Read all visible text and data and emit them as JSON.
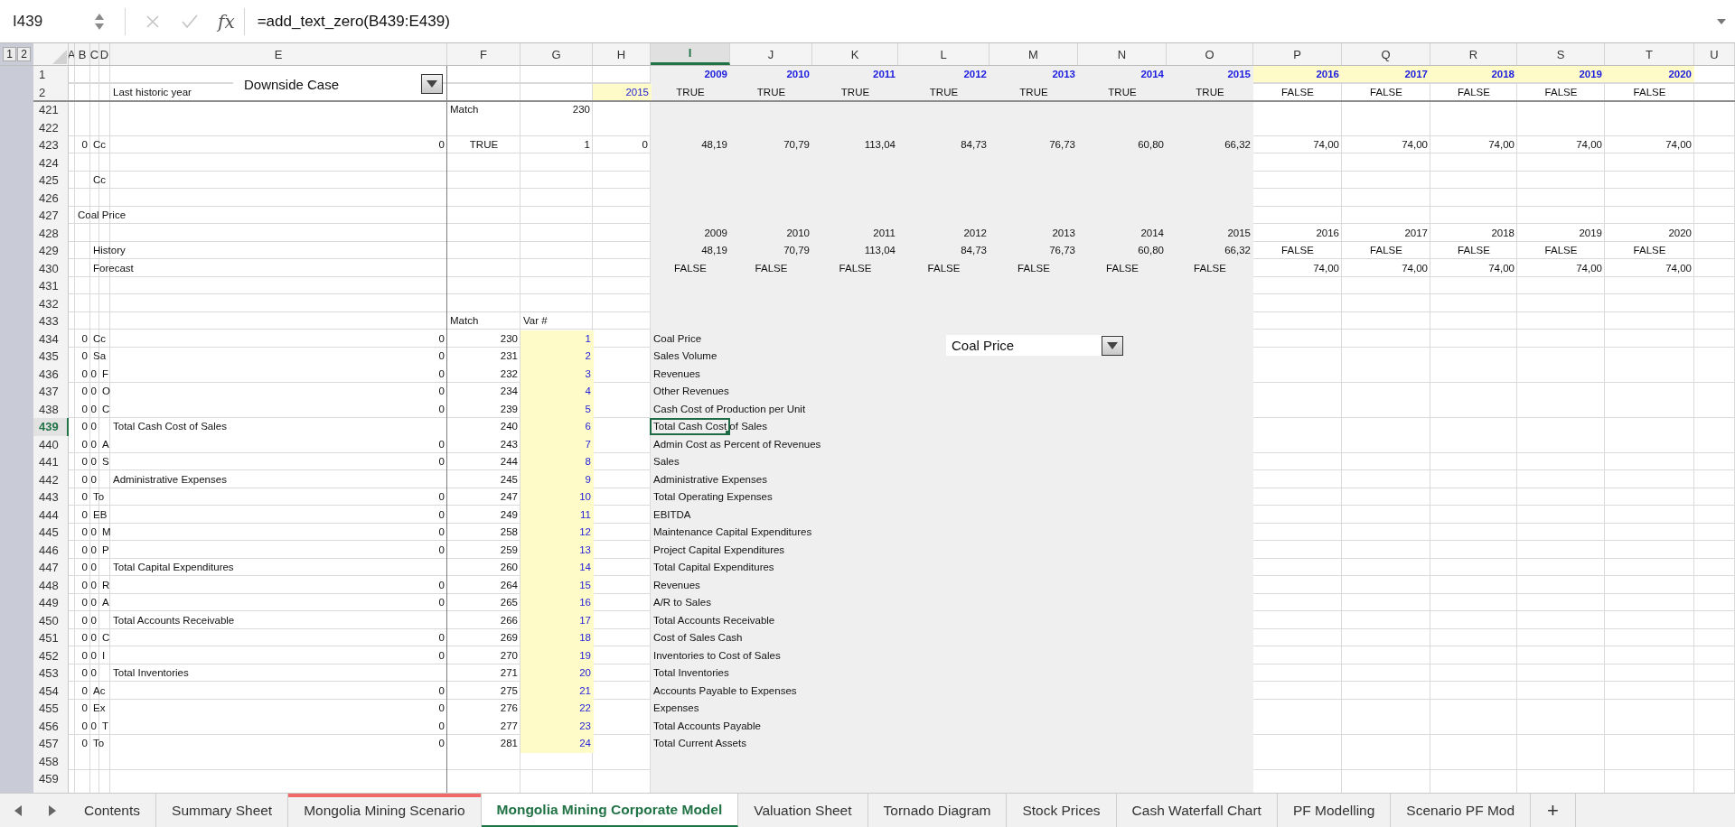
{
  "formula_bar": {
    "name_box": "I439",
    "function_label": "fx",
    "formula": "=add_text_zero(B439:E439)"
  },
  "outline_levels": [
    "1",
    "2"
  ],
  "columns": [
    {
      "label": "A",
      "selected": false,
      "shaded": false
    },
    {
      "label": "B",
      "selected": false,
      "shaded": false
    },
    {
      "label": "C",
      "selected": false,
      "shaded": false
    },
    {
      "label": "D",
      "selected": false,
      "shaded": false
    },
    {
      "label": "E",
      "selected": false,
      "shaded": false
    },
    {
      "label": "F",
      "selected": false,
      "shaded": false
    },
    {
      "label": "G",
      "selected": false,
      "shaded": false
    },
    {
      "label": "H",
      "selected": false,
      "shaded": false
    },
    {
      "label": "I",
      "selected": true,
      "shaded": true
    },
    {
      "label": "J",
      "selected": false,
      "shaded": true
    },
    {
      "label": "K",
      "selected": false,
      "shaded": true
    },
    {
      "label": "L",
      "selected": false,
      "shaded": true
    },
    {
      "label": "M",
      "selected": false,
      "shaded": true
    },
    {
      "label": "N",
      "selected": false,
      "shaded": true
    },
    {
      "label": "O",
      "selected": false,
      "shaded": true
    },
    {
      "label": "P",
      "selected": false,
      "shaded": false
    },
    {
      "label": "Q",
      "selected": false,
      "shaded": false
    },
    {
      "label": "R",
      "selected": false,
      "shaded": false
    },
    {
      "label": "S",
      "selected": false,
      "shaded": false
    },
    {
      "label": "T",
      "selected": false,
      "shaded": false
    },
    {
      "label": "U",
      "selected": false,
      "shaded": false
    }
  ],
  "scenario_dropdown": {
    "value": "Downside Case"
  },
  "rows": [
    {
      "number": "1",
      "selected": false,
      "cells": {
        "I": {
          "text": "2009",
          "kind": "year"
        },
        "J": {
          "text": "2010",
          "kind": "year"
        },
        "K": {
          "text": "2011",
          "kind": "year"
        },
        "L": {
          "text": "2012",
          "kind": "year"
        },
        "M": {
          "text": "2013",
          "kind": "year"
        },
        "N": {
          "text": "2014",
          "kind": "year"
        },
        "O": {
          "text": "2015",
          "kind": "year"
        },
        "P": {
          "text": "2016",
          "kind": "year_hl"
        },
        "Q": {
          "text": "2017",
          "kind": "year_hl"
        },
        "R": {
          "text": "2018",
          "kind": "year_hl"
        },
        "S": {
          "text": "2019",
          "kind": "year_hl"
        },
        "T": {
          "text": "2020",
          "kind": "year_hl"
        }
      }
    },
    {
      "number": "2",
      "selected": false,
      "cells": {
        "E": {
          "text": "Last historic year",
          "kind": "text"
        },
        "H": {
          "text": "2015",
          "kind": "var"
        },
        "I": {
          "text": "TRUE",
          "kind": "bool"
        },
        "J": {
          "text": "TRUE",
          "kind": "bool"
        },
        "K": {
          "text": "TRUE",
          "kind": "bool"
        },
        "L": {
          "text": "TRUE",
          "kind": "bool"
        },
        "M": {
          "text": "TRUE",
          "kind": "bool"
        },
        "N": {
          "text": "TRUE",
          "kind": "bool"
        },
        "O": {
          "text": "TRUE",
          "kind": "bool"
        },
        "P": {
          "text": "FALSE",
          "kind": "bool"
        },
        "Q": {
          "text": "FALSE",
          "kind": "bool"
        },
        "R": {
          "text": "FALSE",
          "kind": "bool"
        },
        "S": {
          "text": "FALSE",
          "kind": "bool"
        },
        "T": {
          "text": "FALSE",
          "kind": "bool"
        }
      }
    },
    {
      "number": "421",
      "selected": false,
      "cells": {
        "F": {
          "text": "Match",
          "kind": "text"
        },
        "G": {
          "text": "230",
          "kind": "num"
        }
      }
    },
    {
      "number": "422",
      "selected": false,
      "cells": {}
    },
    {
      "number": "423",
      "selected": false,
      "cells": {
        "B": {
          "text": "0",
          "kind": "num"
        },
        "C": {
          "text": "Cc",
          "kind": "text"
        },
        "E": {
          "text": "0",
          "kind": "num"
        },
        "F": {
          "text": "TRUE",
          "kind": "bool"
        },
        "G": {
          "text": "1",
          "kind": "num"
        },
        "H": {
          "text": "0",
          "kind": "num"
        },
        "I": {
          "text": "48,19",
          "kind": "num"
        },
        "J": {
          "text": "70,79",
          "kind": "num"
        },
        "K": {
          "text": "113,04",
          "kind": "num"
        },
        "L": {
          "text": "84,73",
          "kind": "num"
        },
        "M": {
          "text": "76,73",
          "kind": "num"
        },
        "N": {
          "text": "60,80",
          "kind": "num"
        },
        "O": {
          "text": "66,32",
          "kind": "num"
        },
        "P": {
          "text": "74,00",
          "kind": "num"
        },
        "Q": {
          "text": "74,00",
          "kind": "num"
        },
        "R": {
          "text": "74,00",
          "kind": "num"
        },
        "S": {
          "text": "74,00",
          "kind": "num"
        },
        "T": {
          "text": "74,00",
          "kind": "num"
        }
      }
    },
    {
      "number": "424",
      "selected": false,
      "cells": {}
    },
    {
      "number": "425",
      "selected": false,
      "cells": {
        "C": {
          "text": "Cc",
          "kind": "text"
        }
      }
    },
    {
      "number": "426",
      "selected": false,
      "cells": {}
    },
    {
      "number": "427",
      "selected": false,
      "cells": {
        "B": {
          "text": "Coal Price",
          "kind": "text"
        }
      }
    },
    {
      "number": "428",
      "selected": false,
      "cells": {
        "I": {
          "text": "2009",
          "kind": "num"
        },
        "J": {
          "text": "2010",
          "kind": "num"
        },
        "K": {
          "text": "2011",
          "kind": "num"
        },
        "L": {
          "text": "2012",
          "kind": "num"
        },
        "M": {
          "text": "2013",
          "kind": "num"
        },
        "N": {
          "text": "2014",
          "kind": "num"
        },
        "O": {
          "text": "2015",
          "kind": "num"
        },
        "P": {
          "text": "2016",
          "kind": "num"
        },
        "Q": {
          "text": "2017",
          "kind": "num"
        },
        "R": {
          "text": "2018",
          "kind": "num"
        },
        "S": {
          "text": "2019",
          "kind": "num"
        },
        "T": {
          "text": "2020",
          "kind": "num"
        }
      }
    },
    {
      "number": "429",
      "selected": false,
      "cells": {
        "C": {
          "text": "History",
          "kind": "text"
        },
        "I": {
          "text": "48,19",
          "kind": "num"
        },
        "J": {
          "text": "70,79",
          "kind": "num"
        },
        "K": {
          "text": "113,04",
          "kind": "num"
        },
        "L": {
          "text": "84,73",
          "kind": "num"
        },
        "M": {
          "text": "76,73",
          "kind": "num"
        },
        "N": {
          "text": "60,80",
          "kind": "num"
        },
        "O": {
          "text": "66,32",
          "kind": "num"
        },
        "P": {
          "text": "FALSE",
          "kind": "bool"
        },
        "Q": {
          "text": "FALSE",
          "kind": "bool"
        },
        "R": {
          "text": "FALSE",
          "kind": "bool"
        },
        "S": {
          "text": "FALSE",
          "kind": "bool"
        },
        "T": {
          "text": "FALSE",
          "kind": "bool"
        }
      }
    },
    {
      "number": "430",
      "selected": false,
      "cells": {
        "C": {
          "text": "Forecast",
          "kind": "text"
        },
        "I": {
          "text": "FALSE",
          "kind": "bool"
        },
        "J": {
          "text": "FALSE",
          "kind": "bool"
        },
        "K": {
          "text": "FALSE",
          "kind": "bool"
        },
        "L": {
          "text": "FALSE",
          "kind": "bool"
        },
        "M": {
          "text": "FALSE",
          "kind": "bool"
        },
        "N": {
          "text": "FALSE",
          "kind": "bool"
        },
        "O": {
          "text": "FALSE",
          "kind": "bool"
        },
        "P": {
          "text": "74,00",
          "kind": "num"
        },
        "Q": {
          "text": "74,00",
          "kind": "num"
        },
        "R": {
          "text": "74,00",
          "kind": "num"
        },
        "S": {
          "text": "74,00",
          "kind": "num"
        },
        "T": {
          "text": "74,00",
          "kind": "num"
        }
      }
    },
    {
      "number": "431",
      "selected": false,
      "cells": {}
    },
    {
      "number": "432",
      "selected": false,
      "cells": {}
    },
    {
      "number": "433",
      "selected": false,
      "cells": {
        "F": {
          "text": "Match",
          "kind": "text"
        },
        "G": {
          "text": "Var #",
          "kind": "text"
        }
      }
    },
    {
      "number": "434",
      "selected": false,
      "cells": {
        "B": {
          "text": "0",
          "kind": "num"
        },
        "C": {
          "text": "Cc",
          "kind": "text"
        },
        "E": {
          "text": "0",
          "kind": "num"
        },
        "F": {
          "text": "230",
          "kind": "num"
        },
        "G": {
          "text": "1",
          "kind": "var"
        },
        "I": {
          "text": "Coal Price",
          "kind": "text"
        }
      }
    },
    {
      "number": "435",
      "selected": false,
      "cells": {
        "B": {
          "text": "0",
          "kind": "num"
        },
        "C": {
          "text": "Sa",
          "kind": "text"
        },
        "E": {
          "text": "0",
          "kind": "num"
        },
        "F": {
          "text": "231",
          "kind": "num"
        },
        "G": {
          "text": "2",
          "kind": "var"
        },
        "I": {
          "text": "Sales Volume",
          "kind": "text"
        }
      }
    },
    {
      "number": "436",
      "selected": false,
      "cells": {
        "B": {
          "text": "0",
          "kind": "num"
        },
        "C": {
          "text": "0",
          "kind": "num"
        },
        "D": {
          "text": "F",
          "kind": "text"
        },
        "E": {
          "text": "0",
          "kind": "num"
        },
        "F": {
          "text": "232",
          "kind": "num"
        },
        "G": {
          "text": "3",
          "kind": "var"
        },
        "I": {
          "text": "Revenues",
          "kind": "text"
        }
      }
    },
    {
      "number": "437",
      "selected": false,
      "cells": {
        "B": {
          "text": "0",
          "kind": "num"
        },
        "C": {
          "text": "0",
          "kind": "num"
        },
        "D": {
          "text": "O",
          "kind": "text"
        },
        "E": {
          "text": "0",
          "kind": "num"
        },
        "F": {
          "text": "234",
          "kind": "num"
        },
        "G": {
          "text": "4",
          "kind": "var"
        },
        "I": {
          "text": "Other Revenues",
          "kind": "text"
        }
      }
    },
    {
      "number": "438",
      "selected": false,
      "cells": {
        "B": {
          "text": "0",
          "kind": "num"
        },
        "C": {
          "text": "0",
          "kind": "num"
        },
        "D": {
          "text": "C",
          "kind": "text"
        },
        "E": {
          "text": "0",
          "kind": "num"
        },
        "F": {
          "text": "239",
          "kind": "num"
        },
        "G": {
          "text": "5",
          "kind": "var"
        },
        "I": {
          "text": "Cash Cost of Production per Unit",
          "kind": "text"
        }
      }
    },
    {
      "number": "439",
      "selected": true,
      "cells": {
        "B": {
          "text": "0",
          "kind": "num"
        },
        "C": {
          "text": "0",
          "kind": "num"
        },
        "E": {
          "text": "Total Cash Cost of Sales",
          "kind": "text"
        },
        "F": {
          "text": "240",
          "kind": "num"
        },
        "G": {
          "text": "6",
          "kind": "var"
        },
        "I": {
          "text": "Total Cash Cost of Sales",
          "kind": "text"
        }
      }
    },
    {
      "number": "440",
      "selected": false,
      "cells": {
        "B": {
          "text": "0",
          "kind": "num"
        },
        "C": {
          "text": "0",
          "kind": "num"
        },
        "D": {
          "text": "A",
          "kind": "text"
        },
        "E": {
          "text": "0",
          "kind": "num"
        },
        "F": {
          "text": "243",
          "kind": "num"
        },
        "G": {
          "text": "7",
          "kind": "var"
        },
        "I": {
          "text": "Admin Cost as Percent of Revenues",
          "kind": "text"
        }
      }
    },
    {
      "number": "441",
      "selected": false,
      "cells": {
        "B": {
          "text": "0",
          "kind": "num"
        },
        "C": {
          "text": "0",
          "kind": "num"
        },
        "D": {
          "text": "S",
          "kind": "text"
        },
        "E": {
          "text": "0",
          "kind": "num"
        },
        "F": {
          "text": "244",
          "kind": "num"
        },
        "G": {
          "text": "8",
          "kind": "var"
        },
        "I": {
          "text": "Sales",
          "kind": "text"
        }
      }
    },
    {
      "number": "442",
      "selected": false,
      "cells": {
        "B": {
          "text": "0",
          "kind": "num"
        },
        "C": {
          "text": "0",
          "kind": "num"
        },
        "E": {
          "text": "Administrative Expenses",
          "kind": "text"
        },
        "F": {
          "text": "245",
          "kind": "num"
        },
        "G": {
          "text": "9",
          "kind": "var"
        },
        "I": {
          "text": "Administrative Expenses",
          "kind": "text"
        }
      }
    },
    {
      "number": "443",
      "selected": false,
      "cells": {
        "B": {
          "text": "0",
          "kind": "num"
        },
        "C": {
          "text": "To",
          "kind": "text"
        },
        "E": {
          "text": "0",
          "kind": "num"
        },
        "F": {
          "text": "247",
          "kind": "num"
        },
        "G": {
          "text": "10",
          "kind": "var"
        },
        "I": {
          "text": "Total Operating Expenses",
          "kind": "text"
        }
      }
    },
    {
      "number": "444",
      "selected": false,
      "cells": {
        "B": {
          "text": "0",
          "kind": "num"
        },
        "C": {
          "text": "EB",
          "kind": "text"
        },
        "E": {
          "text": "0",
          "kind": "num"
        },
        "F": {
          "text": "249",
          "kind": "num"
        },
        "G": {
          "text": "11",
          "kind": "var"
        },
        "I": {
          "text": "EBITDA",
          "kind": "text"
        }
      }
    },
    {
      "number": "445",
      "selected": false,
      "cells": {
        "B": {
          "text": "0",
          "kind": "num"
        },
        "C": {
          "text": "0",
          "kind": "num"
        },
        "D": {
          "text": "M",
          "kind": "text"
        },
        "E": {
          "text": "0",
          "kind": "num"
        },
        "F": {
          "text": "258",
          "kind": "num"
        },
        "G": {
          "text": "12",
          "kind": "var"
        },
        "I": {
          "text": "Maintenance Capital Expenditures",
          "kind": "text"
        }
      }
    },
    {
      "number": "446",
      "selected": false,
      "cells": {
        "B": {
          "text": "0",
          "kind": "num"
        },
        "C": {
          "text": "0",
          "kind": "num"
        },
        "D": {
          "text": "P",
          "kind": "text"
        },
        "E": {
          "text": "0",
          "kind": "num"
        },
        "F": {
          "text": "259",
          "kind": "num"
        },
        "G": {
          "text": "13",
          "kind": "var"
        },
        "I": {
          "text": "Project Capital Expenditures",
          "kind": "text"
        }
      }
    },
    {
      "number": "447",
      "selected": false,
      "cells": {
        "B": {
          "text": "0",
          "kind": "num"
        },
        "C": {
          "text": "0",
          "kind": "num"
        },
        "E": {
          "text": "Total Capital Expenditures",
          "kind": "text"
        },
        "F": {
          "text": "260",
          "kind": "num"
        },
        "G": {
          "text": "14",
          "kind": "var"
        },
        "I": {
          "text": "Total Capital Expenditures",
          "kind": "text"
        }
      }
    },
    {
      "number": "448",
      "selected": false,
      "cells": {
        "B": {
          "text": "0",
          "kind": "num"
        },
        "C": {
          "text": "0",
          "kind": "num"
        },
        "D": {
          "text": "R",
          "kind": "text"
        },
        "E": {
          "text": "0",
          "kind": "num"
        },
        "F": {
          "text": "264",
          "kind": "num"
        },
        "G": {
          "text": "15",
          "kind": "var"
        },
        "I": {
          "text": "Revenues",
          "kind": "text"
        }
      }
    },
    {
      "number": "449",
      "selected": false,
      "cells": {
        "B": {
          "text": "0",
          "kind": "num"
        },
        "C": {
          "text": "0",
          "kind": "num"
        },
        "D": {
          "text": "A",
          "kind": "text"
        },
        "E": {
          "text": "0",
          "kind": "num"
        },
        "F": {
          "text": "265",
          "kind": "num"
        },
        "G": {
          "text": "16",
          "kind": "var"
        },
        "I": {
          "text": "A/R to Sales",
          "kind": "text"
        }
      }
    },
    {
      "number": "450",
      "selected": false,
      "cells": {
        "B": {
          "text": "0",
          "kind": "num"
        },
        "C": {
          "text": "0",
          "kind": "num"
        },
        "E": {
          "text": "Total Accounts Receivable",
          "kind": "text"
        },
        "F": {
          "text": "266",
          "kind": "num"
        },
        "G": {
          "text": "17",
          "kind": "var"
        },
        "I": {
          "text": "Total Accounts Receivable",
          "kind": "text"
        }
      }
    },
    {
      "number": "451",
      "selected": false,
      "cells": {
        "B": {
          "text": "0",
          "kind": "num"
        },
        "C": {
          "text": "0",
          "kind": "num"
        },
        "D": {
          "text": "C",
          "kind": "text"
        },
        "E": {
          "text": "0",
          "kind": "num"
        },
        "F": {
          "text": "269",
          "kind": "num"
        },
        "G": {
          "text": "18",
          "kind": "var"
        },
        "I": {
          "text": "Cost of Sales Cash",
          "kind": "text"
        }
      }
    },
    {
      "number": "452",
      "selected": false,
      "cells": {
        "B": {
          "text": "0",
          "kind": "num"
        },
        "C": {
          "text": "0",
          "kind": "num"
        },
        "D": {
          "text": "I",
          "kind": "text"
        },
        "E": {
          "text": "0",
          "kind": "num"
        },
        "F": {
          "text": "270",
          "kind": "num"
        },
        "G": {
          "text": "19",
          "kind": "var"
        },
        "I": {
          "text": "Inventories to Cost of Sales",
          "kind": "text"
        }
      }
    },
    {
      "number": "453",
      "selected": false,
      "cells": {
        "B": {
          "text": "0",
          "kind": "num"
        },
        "C": {
          "text": "0",
          "kind": "num"
        },
        "E": {
          "text": "Total Inventories",
          "kind": "text"
        },
        "F": {
          "text": "271",
          "kind": "num"
        },
        "G": {
          "text": "20",
          "kind": "var"
        },
        "I": {
          "text": "Total Inventories",
          "kind": "text"
        }
      }
    },
    {
      "number": "454",
      "selected": false,
      "cells": {
        "B": {
          "text": "0",
          "kind": "num"
        },
        "C": {
          "text": "Ac",
          "kind": "text"
        },
        "E": {
          "text": "0",
          "kind": "num"
        },
        "F": {
          "text": "275",
          "kind": "num"
        },
        "G": {
          "text": "21",
          "kind": "var"
        },
        "I": {
          "text": "Accounts Payable to Expenses",
          "kind": "text"
        }
      }
    },
    {
      "number": "455",
      "selected": false,
      "cells": {
        "B": {
          "text": "0",
          "kind": "num"
        },
        "C": {
          "text": "Ex",
          "kind": "text"
        },
        "E": {
          "text": "0",
          "kind": "num"
        },
        "F": {
          "text": "276",
          "kind": "num"
        },
        "G": {
          "text": "22",
          "kind": "var"
        },
        "I": {
          "text": "Expenses",
          "kind": "text"
        }
      }
    },
    {
      "number": "456",
      "selected": false,
      "cells": {
        "B": {
          "text": "0",
          "kind": "num"
        },
        "C": {
          "text": "0",
          "kind": "num"
        },
        "D": {
          "text": "T",
          "kind": "text"
        },
        "E": {
          "text": "0",
          "kind": "num"
        },
        "F": {
          "text": "277",
          "kind": "num"
        },
        "G": {
          "text": "23",
          "kind": "var"
        },
        "I": {
          "text": "Total Accounts Payable",
          "kind": "text"
        }
      }
    },
    {
      "number": "457",
      "selected": false,
      "cells": {
        "B": {
          "text": "0",
          "kind": "num"
        },
        "C": {
          "text": "To",
          "kind": "text"
        },
        "E": {
          "text": "0",
          "kind": "num"
        },
        "F": {
          "text": "281",
          "kind": "num"
        },
        "G": {
          "text": "24",
          "kind": "var"
        },
        "I": {
          "text": "Total Current Assets",
          "kind": "text"
        }
      }
    },
    {
      "number": "458",
      "selected": false,
      "cells": {}
    },
    {
      "number": "459",
      "selected": false,
      "cells": {}
    }
  ],
  "chart_selector": {
    "value": "Coal Price"
  },
  "sheet_tabs": [
    {
      "label": "Contents",
      "selected": false
    },
    {
      "label": "Summary Sheet",
      "selected": false
    },
    {
      "label": "Mongolia Mining Scenario",
      "selected": false,
      "color": "#f06a6a"
    },
    {
      "label": "Mongolia Mining Corporate Model",
      "selected": true
    },
    {
      "label": "Valuation Sheet",
      "selected": false
    },
    {
      "label": "Tornado Diagram",
      "selected": false
    },
    {
      "label": "Stock Prices",
      "selected": false
    },
    {
      "label": "Cash Waterfall Chart",
      "selected": false
    },
    {
      "label": "PF Modelling",
      "selected": false
    },
    {
      "label": "Scenario PF Mod",
      "selected": false
    }
  ],
  "add_sheet": "+"
}
